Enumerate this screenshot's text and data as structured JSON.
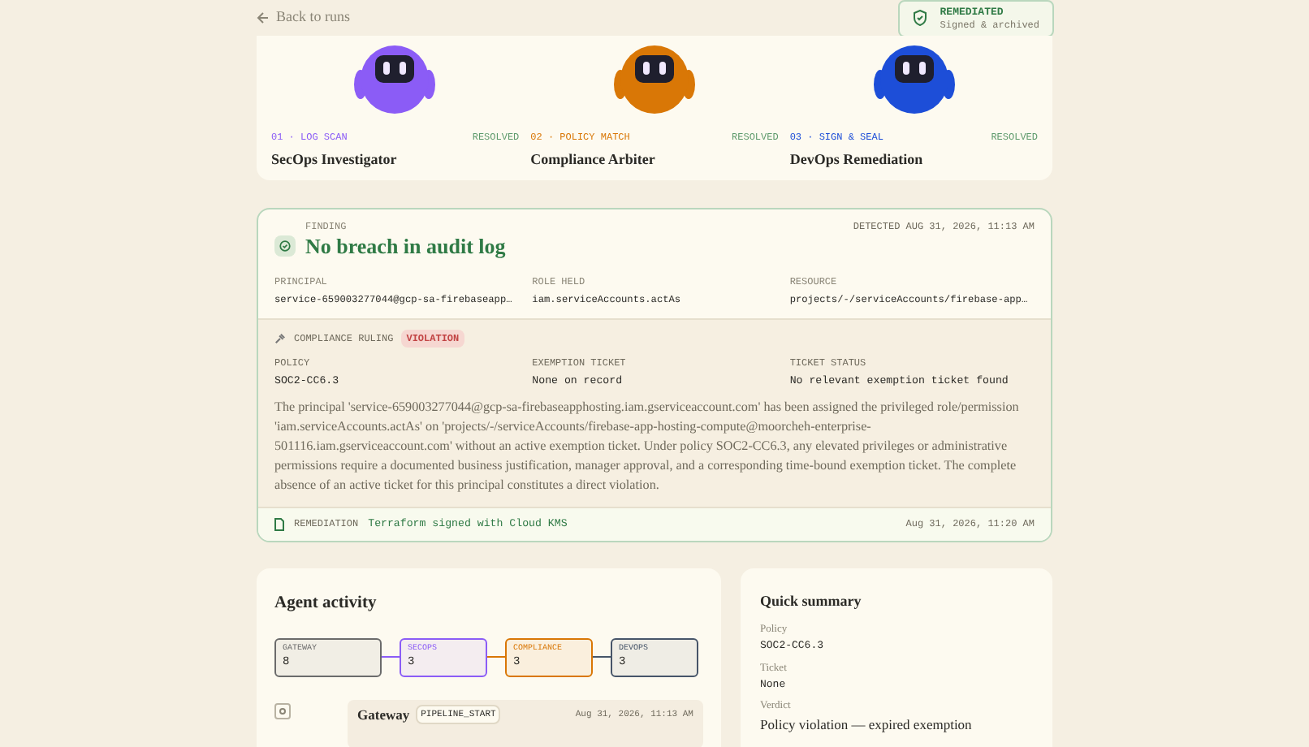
{
  "back_link": "Back to runs",
  "status_badge": {
    "title": "REMEDIATED",
    "subtitle": "Signed & archived"
  },
  "agents": [
    {
      "step": "01 · LOG SCAN",
      "status": "RESOLVED",
      "name": "SecOps Investigator",
      "color": "#8b5cf6"
    },
    {
      "step": "02 · POLICY MATCH",
      "status": "RESOLVED",
      "name": "Compliance Arbiter",
      "color": "#d97706"
    },
    {
      "step": "03 · SIGN & SEAL",
      "status": "RESOLVED",
      "name": "DevOps Remediation",
      "color": "#1d4ed8"
    }
  ],
  "finding": {
    "label": "FINDING",
    "title": "No breach in audit log",
    "detected": "DETECTED AUG 31, 2026, 11:13 AM",
    "fields": [
      {
        "label": "PRINCIPAL",
        "value": "service-659003277044@gcp-sa-firebaseapp…"
      },
      {
        "label": "ROLE HELD",
        "value": "iam.serviceAccounts.actAs"
      },
      {
        "label": "RESOURCE",
        "value": "projects/-/serviceAccounts/firebase-app…"
      }
    ],
    "ruling": {
      "label": "COMPLIANCE RULING",
      "verdict": "VIOLATION",
      "fields": [
        {
          "label": "POLICY",
          "value": "SOC2-CC6.3"
        },
        {
          "label": "EXEMPTION TICKET",
          "value": "None on record"
        },
        {
          "label": "TICKET STATUS",
          "value": "No relevant exemption ticket found"
        }
      ],
      "text": "The principal 'service-659003277044@gcp-sa-firebaseapphosting.iam.gserviceaccount.com' has been assigned the privileged role/permission 'iam.serviceAccounts.actAs' on 'projects/-/serviceAccounts/firebase-app-hosting-compute@moorcheh-enterprise-501116.iam.gserviceaccount.com' without an active exemption ticket. Under policy SOC2-CC6.3, any elevated privileges or administrative permissions require a documented business justification, manager approval, and a corresponding time-bound exemption ticket. The complete absence of an active ticket for this principal constitutes a direct violation."
    },
    "remediation": {
      "label": "REMEDIATION",
      "value": "Terraform signed with Cloud KMS",
      "time": "Aug 31, 2026, 11:20 AM"
    }
  },
  "activity": {
    "title": "Agent activity",
    "nodes": [
      {
        "label": "GATEWAY",
        "count": "8",
        "color": "#6b6b6b"
      },
      {
        "label": "SECOPS",
        "count": "3",
        "color": "#8b5cf6"
      },
      {
        "label": "COMPLIANCE",
        "count": "3",
        "color": "#d97706"
      },
      {
        "label": "DEVOPS",
        "count": "3",
        "color": "#475569"
      }
    ],
    "events": [
      {
        "agent": "Gateway",
        "tag": "PIPELINE_START",
        "time": "Aug 31, 2026, 11:13 AM"
      }
    ]
  },
  "summary": {
    "title": "Quick summary",
    "items": [
      {
        "label": "Policy",
        "value": "SOC2-CC6.3",
        "kind": "code"
      },
      {
        "label": "Ticket",
        "value": "None",
        "kind": "code"
      },
      {
        "label": "Verdict",
        "value": "Policy violation — expired exemption",
        "kind": "text"
      }
    ]
  }
}
